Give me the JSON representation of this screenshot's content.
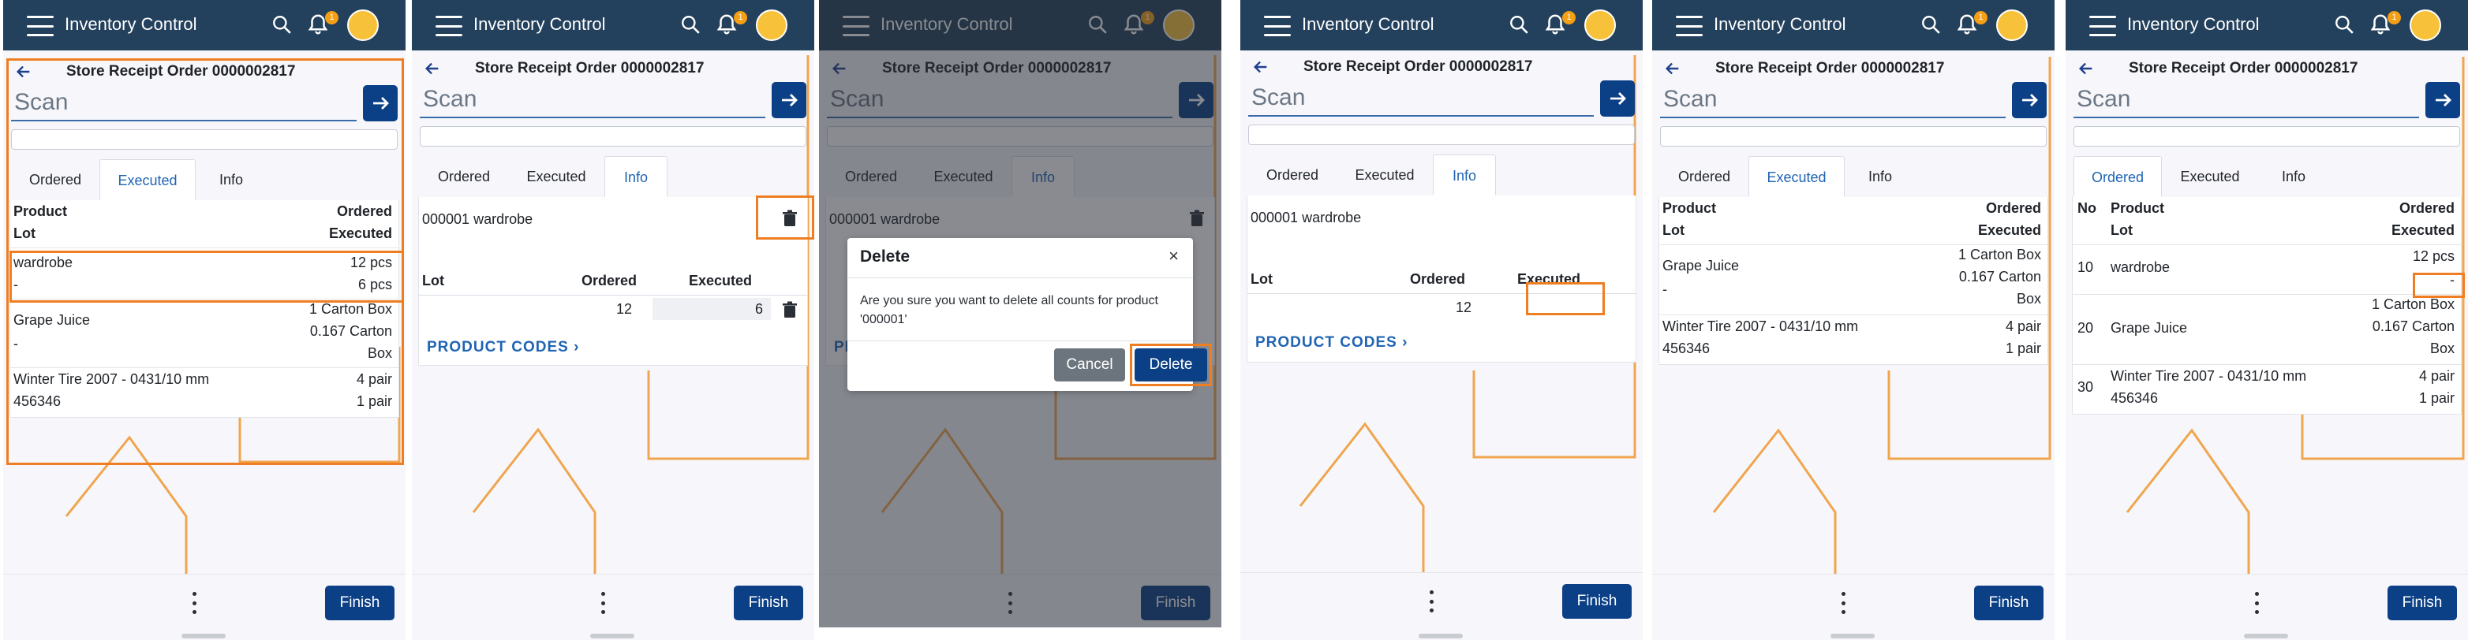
{
  "app": {
    "title": "Inventory Control",
    "notifications": "1",
    "finish_label": "Finish"
  },
  "order": {
    "title": "Store Receipt Order 0000002817"
  },
  "scan": {
    "placeholder": "Scan"
  },
  "tabs": [
    "Ordered",
    "Executed",
    "Info"
  ],
  "headers": {
    "product": "Product",
    "lot": "Lot",
    "ordered": "Ordered",
    "executed": "Executed",
    "no": "No"
  },
  "items": [
    {
      "no": "10",
      "name": "wardrobe",
      "lot": "-",
      "ordered": "12 pcs",
      "executed": "6 pcs"
    },
    {
      "no": "20",
      "name": "Grape Juice",
      "lot": "-",
      "ordered_lines": [
        "1 Carton Box",
        "0.167 Carton",
        "Box"
      ]
    },
    {
      "no": "30",
      "name": "Winter Tire 2007 - 0431/10 mm",
      "lot": "456346",
      "ordered": "4 pair",
      "executed": "1 pair"
    }
  ],
  "info": {
    "product_line": "000001 wardrobe",
    "ordered_value": "12",
    "executed_value": "6",
    "product_codes": "PRODUCT CODES"
  },
  "dialog": {
    "title": "Delete",
    "close": "×",
    "message": "Are you sure you want to delete all counts for product '000001'",
    "cancel": "Cancel",
    "delete": "Delete"
  },
  "colors": {
    "topbar": "#23405c",
    "primary": "#0b3f86",
    "accent": "#f59f14",
    "highlight": "#ef7d22",
    "link": "#1f64b3"
  },
  "icons": [
    "menu-icon",
    "search-icon",
    "bell-icon",
    "avatar",
    "back-arrow-icon",
    "arrow-right-icon",
    "trash-icon",
    "more-vertical-icon",
    "chevron-right-icon",
    "close-icon"
  ]
}
